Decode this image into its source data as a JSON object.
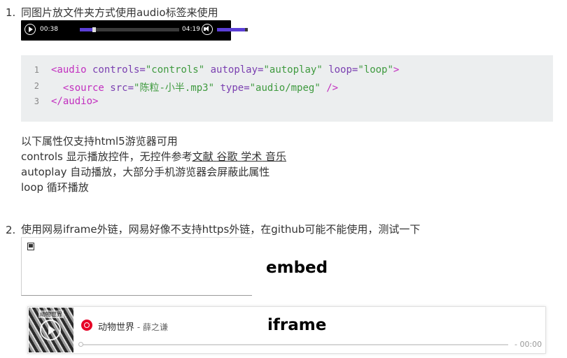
{
  "item1": {
    "number": "1.",
    "heading": "同图片放文件夹方式使用audio标签来使用",
    "player": {
      "current_time": "00:38",
      "duration": "04:19",
      "progress_fraction": 0.14,
      "volume_fraction": 0.9,
      "play_icon": "play-icon",
      "volume_icon": "volume-icon"
    },
    "code": {
      "line_numbers": [
        "1",
        "2",
        "3"
      ],
      "line1": {
        "open": "<audio",
        "attr1": " controls=",
        "val1": "\"controls\"",
        "attr2": " autoplay=",
        "val2": "\"autoplay\"",
        "attr3": " loop=",
        "val3": "\"loop\"",
        "close": ">"
      },
      "line2": {
        "indent": "  ",
        "open": "<source",
        "attr1": " src=",
        "val1": "\"陈粒-小半.mp3\"",
        "attr2": " type=",
        "val2": "\"audio/mpeg\"",
        "close": " />"
      },
      "line3": {
        "close_tag": "</audio>"
      }
    },
    "notes": {
      "line1": "以下属性仅支持html5游览器可用",
      "line2_prefix": "controls 显示播放控件，无控件参考",
      "links": [
        "文献",
        "谷歌",
        "学术",
        "音乐"
      ],
      "line3": "autoplay 自动播放，大部分手机游览器会屏蔽此属性",
      "line4": "loop 循环播放"
    }
  },
  "item2": {
    "number": "2.",
    "heading": "使用网易iframe外链，网易好像不支持https外链，在github可能不能使用，测试一下",
    "embed_label": "embed",
    "iframe_label": "iframe",
    "widget": {
      "cover_title": "动物世界",
      "song_title": "动物世界",
      "separator": " - ",
      "artist": "薛之谦",
      "time": "- 00:00",
      "progress_fraction": 0,
      "brand_icon": "netease-music-icon"
    }
  },
  "colors": {
    "tag": "#c22fbf",
    "attribute": "#7a3fb0",
    "string": "#3f9a3f",
    "code_bg": "#eceeef",
    "player_accent": "#5b3fd6",
    "netease_red": "#e60026"
  }
}
